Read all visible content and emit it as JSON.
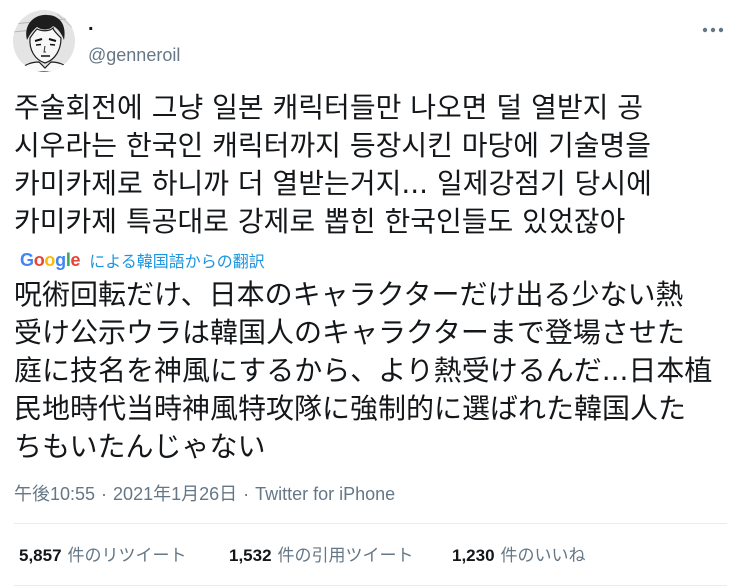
{
  "tweet": {
    "author": {
      "display_name": ".",
      "handle": "@genneroil"
    },
    "icons": {
      "more": "more-horizontal-icon",
      "avatar": "avatar-image"
    },
    "text_lines": [
      "주술회전에 그냥 일본 캐릭터들만 나오면 덜 열받지 공",
      "시우라는 한국인 캐릭터까지 등장시킨 마당에 기술명을",
      "카미카제로 하니까 더 열받는거지... 일제강점기 당시에",
      "카미카제 특공대로 강제로 뽑힌 한국인들도 있었잖아"
    ],
    "translation": {
      "provider_logo": "Google",
      "attribution_label": "による韓国語からの翻訳",
      "text_lines": [
        "呪術回転だけ、日本のキャラクターだけ出る少ない熱",
        "受け公示ウラは韓国人のキャラクターまで登場させた",
        "庭に技名を神風にするから、より熱受けるんだ...日本植",
        "民地時代当時神風特攻隊に強制的に選ばれた韓国人た",
        "ちもいたんじゃない"
      ]
    },
    "meta": {
      "time": "午後10:55",
      "separator": "·",
      "date": "2021年1月26日",
      "source": "Twitter for iPhone"
    },
    "stats": [
      {
        "count": "5,857",
        "label": "件のリツイート"
      },
      {
        "count": "1,532",
        "label": "件の引用ツイート"
      },
      {
        "count": "1,230",
        "label": "件のいいね"
      }
    ]
  },
  "colors": {
    "text": "#14171a",
    "secondary": "#657786",
    "link": "#1b95e0",
    "divider": "#e6ecf0",
    "google_logo": [
      "#4285F4",
      "#EA4335",
      "#FBBC05",
      "#4285F4",
      "#34A853",
      "#EA4335"
    ]
  }
}
